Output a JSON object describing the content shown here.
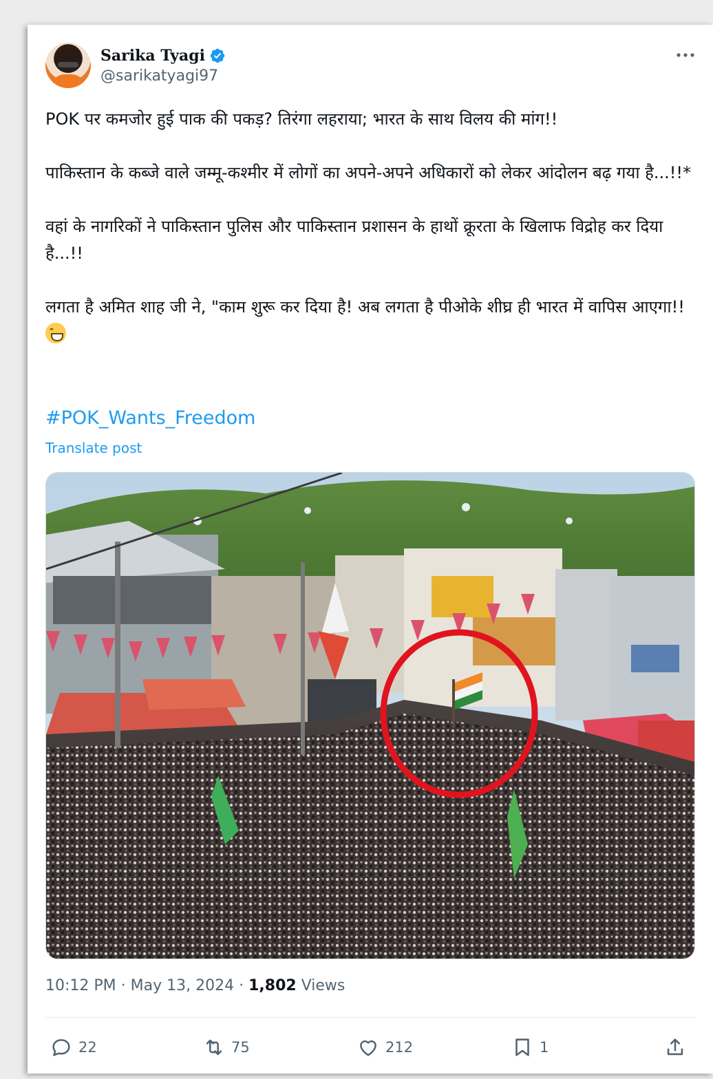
{
  "author": {
    "name": "Sarika Tyagi",
    "handle": "@sarikatyagi97"
  },
  "post": {
    "text": "POK पर कमजोर हुई पाक की पकड़? तिरंगा लहराया; भारत के साथ विलय की मांग!!\n\nपाकिस्तान के कब्जे वाले जम्मू-कश्मीर में लोगों का अपने-अपने अधिकारों को लेकर आंदोलन बढ़ गया है...!!*\n\nवहां के नागरिकों ने पाकिस्तान पुलिस और पाकिस्तान प्रशासन के हाथों क्रूरता के खिलाफ विद्रोह कर दिया है...!!\n\nलगता है अमित शाह जी ने, \"काम शुरू कर दिया है! अब लगता है पीओके शीघ्र ही भारत में वापिस आएगा!!",
    "emoji": "grinning-face-emoji",
    "hashtag": "#POK_Wants_Freedom",
    "translate_label": "Translate post"
  },
  "meta": {
    "time": "10:12 PM",
    "separator": "·",
    "date": "May 13, 2024",
    "views_count": "1,802",
    "views_label": "Views"
  },
  "actions": {
    "replies": "22",
    "reposts": "75",
    "likes": "212",
    "bookmarks": "1"
  },
  "icons": [
    "verified-badge-icon",
    "more-icon",
    "reply-icon",
    "repost-icon",
    "like-icon",
    "bookmark-icon",
    "share-icon"
  ],
  "colors": {
    "accent": "#1d9bf0",
    "secondary_text": "#536471",
    "primary_text": "#0f1419"
  }
}
